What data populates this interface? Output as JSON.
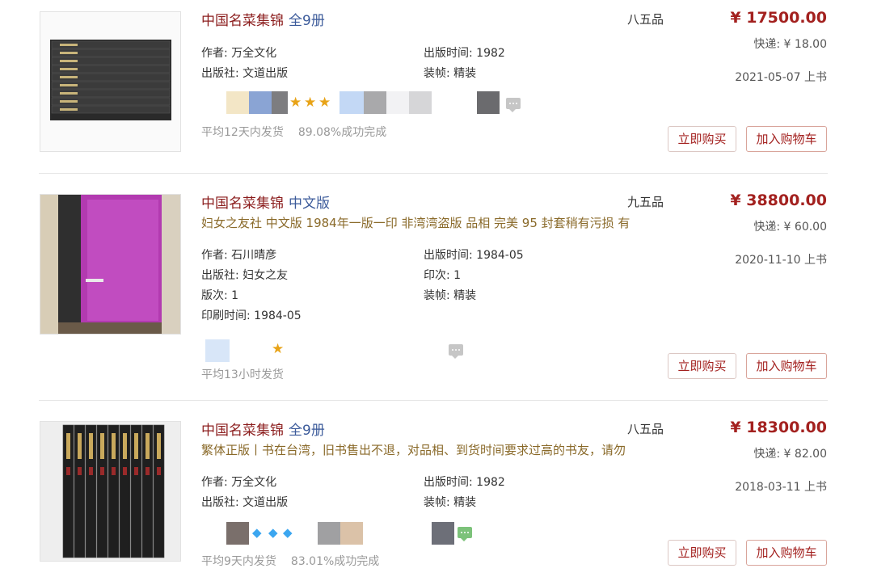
{
  "items": [
    {
      "title": "中国名菜集锦",
      "subtitle": "全9册",
      "description": "",
      "quality": "八五品",
      "price": "¥ 17500.00",
      "shipping": "快递: ¥ 18.00",
      "listed": "2021-05-07 上书",
      "fields": {
        "author": "作者: 万全文化",
        "publisher": "出版社: 文道出版",
        "pub_date": "出版时间: 1982",
        "binding": "装帧: 精装"
      },
      "meta": {
        "dispatch": "平均12天内发货",
        "rate": "89.08%成功完成"
      },
      "buy_label": "立即购买",
      "cart_label": "加入购物车"
    },
    {
      "title": "中国名菜集锦",
      "subtitle": "中文版",
      "description": "妇女之友社 中文版 1984年一版一印 非湾湾盗版 品相 完美 95 封套稍有污损 有",
      "quality": "九五品",
      "price": "¥ 38800.00",
      "shipping": "快递: ¥ 60.00",
      "listed": "2020-11-10 上书",
      "fields": {
        "author": "作者: 石川晴彦",
        "publisher": "出版社: 妇女之友",
        "edition": "版次: 1",
        "print_date": "印刷时间: 1984-05",
        "pub_date": "出版时间: 1984-05",
        "printing": "印次: 1",
        "binding": "装帧: 精装"
      },
      "meta": {
        "dispatch": "平均13小时发货"
      },
      "buy_label": "立即购买",
      "cart_label": "加入购物车"
    },
    {
      "title": "中国名菜集锦",
      "subtitle": "全9册",
      "description": "繁体正版丨书在台湾，旧书售出不退，对品相、到货时间要求过高的书友，请勿",
      "quality": "八五品",
      "price": "¥ 18300.00",
      "shipping": "快递: ¥ 82.00",
      "listed": "2018-03-11 上书",
      "fields": {
        "author": "作者: 万全文化",
        "publisher": "出版社: 文道出版",
        "pub_date": "出版时间: 1982",
        "binding": "装帧: 精装"
      },
      "meta": {
        "dispatch": "平均9天内发货",
        "rate": "83.01%成功完成"
      },
      "buy_label": "立即购买",
      "cart_label": "加入购物车"
    }
  ],
  "icons": {
    "rating_star": "star-icon",
    "rating_diamond": "diamond-icon",
    "chat": "chat-icon"
  },
  "colors": {
    "title": "#8b1c1c",
    "subtitle": "#3b5a9a",
    "price": "#a3211f",
    "description": "#8a6a2a",
    "star": "#e8a317",
    "diamond": "#3ba6f0"
  },
  "ratings": {
    "item1_stars": 3,
    "item2_stars": 1,
    "item3_diamonds": 3
  }
}
